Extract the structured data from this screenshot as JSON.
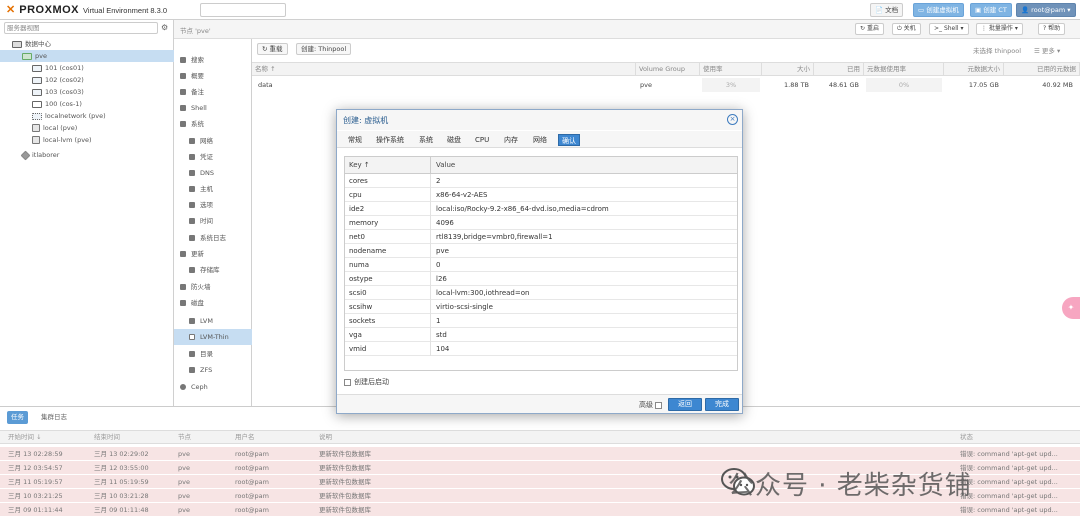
{
  "topbar": {
    "logo_brand": "PROXMOX",
    "logo_product": "Virtual Environment 8.3.0",
    "search_placeholder": "搜索",
    "docs_label": "文档",
    "create_vm_label": "创建虚拟机",
    "create_ct_label": "创建 CT",
    "user_label": "root@pam"
  },
  "tree": {
    "view_label": "服务器视图",
    "items": [
      {
        "label": "数据中心",
        "type": "datacenter"
      },
      {
        "label": "pve",
        "type": "node"
      },
      {
        "label": "101 (cos01)",
        "type": "vm"
      },
      {
        "label": "102 (cos02)",
        "type": "vm"
      },
      {
        "label": "103 (cos03)",
        "type": "vm"
      },
      {
        "label": "100 (cos-1)",
        "type": "vm"
      },
      {
        "label": "localnetwork (pve)",
        "type": "network"
      },
      {
        "label": "local (pve)",
        "type": "storage"
      },
      {
        "label": "local-lvm (pve)",
        "type": "storage"
      },
      {
        "label": "itlaborer",
        "type": "tag"
      }
    ]
  },
  "header": {
    "breadcrumb": "节点 'pve'",
    "btn_restart": "重启",
    "btn_shutdown": "关机",
    "btn_shell": "Shell",
    "btn_bulk": "批量操作",
    "btn_help": "帮助"
  },
  "nav": {
    "items": [
      {
        "label": "搜索",
        "sub": false
      },
      {
        "label": "概要",
        "sub": false
      },
      {
        "label": "备注",
        "sub": false
      },
      {
        "label": "Shell",
        "sub": false
      },
      {
        "label": "系统",
        "sub": false
      },
      {
        "label": "网络",
        "sub": true
      },
      {
        "label": "凭证",
        "sub": true
      },
      {
        "label": "DNS",
        "sub": true
      },
      {
        "label": "主机",
        "sub": true
      },
      {
        "label": "选项",
        "sub": true
      },
      {
        "label": "时间",
        "sub": true
      },
      {
        "label": "系统日志",
        "sub": true
      },
      {
        "label": "更新",
        "sub": false
      },
      {
        "label": "存储库",
        "sub": true
      },
      {
        "label": "防火墙",
        "sub": false
      },
      {
        "label": "磁盘",
        "sub": false
      },
      {
        "label": "LVM",
        "sub": true
      },
      {
        "label": "LVM-Thin",
        "sub": true
      },
      {
        "label": "目录",
        "sub": true
      },
      {
        "label": "ZFS",
        "sub": true
      },
      {
        "label": "Ceph",
        "sub": false
      }
    ]
  },
  "main": {
    "toolbar": {
      "reload": "重载",
      "create_thinpool": "创建: Thinpool",
      "selected_label": "未选择 thinpool",
      "more_label": "更多"
    },
    "columns": [
      "名称 ↑",
      "Volume Group",
      "使用率",
      "大小",
      "已用",
      "元数据使用率",
      "元数据大小",
      "已用的元数据"
    ],
    "rows": [
      {
        "name": "data",
        "vg": "pve",
        "usage": "3%",
        "size": "1.88 TB",
        "used": "48.61 GB",
        "meta_usage": "0%",
        "meta_size": "17.05 GB",
        "meta_used": "40.92 MB"
      }
    ]
  },
  "dialog": {
    "title": "创建: 虚拟机",
    "tabs": [
      "常规",
      "操作系统",
      "系统",
      "磁盘",
      "CPU",
      "内存",
      "网络",
      "确认"
    ],
    "active_tab": "确认",
    "col_key": "Key ↑",
    "col_value": "Value",
    "rows": [
      {
        "k": "cores",
        "v": "2"
      },
      {
        "k": "cpu",
        "v": "x86-64-v2-AES"
      },
      {
        "k": "ide2",
        "v": "local:iso/Rocky-9.2-x86_64-dvd.iso,media=cdrom"
      },
      {
        "k": "memory",
        "v": "4096"
      },
      {
        "k": "net0",
        "v": "rtl8139,bridge=vmbr0,firewall=1"
      },
      {
        "k": "nodename",
        "v": "pve"
      },
      {
        "k": "numa",
        "v": "0"
      },
      {
        "k": "ostype",
        "v": "l26"
      },
      {
        "k": "scsi0",
        "v": "local-lvm:300,iothread=on"
      },
      {
        "k": "scsihw",
        "v": "virtio-scsi-single"
      },
      {
        "k": "sockets",
        "v": "1"
      },
      {
        "k": "vga",
        "v": "std"
      },
      {
        "k": "vmid",
        "v": "104"
      }
    ],
    "start_after_label": "创建后启动",
    "advanced_label": "高级",
    "back_label": "返回",
    "finish_label": "完成"
  },
  "bottom": {
    "tab_tasks": "任务",
    "tab_cluster_log": "集群日志",
    "columns": [
      "开始时间 ↓",
      "结束时间",
      "节点",
      "用户名",
      "说明",
      "状态"
    ],
    "rows": [
      {
        "start": "三月 13 02:28:59",
        "end": "三月 13 02:29:02",
        "node": "pve",
        "user": "root@pam",
        "desc": "更新软件包数据库",
        "status": "错误: command 'apt-get upd..."
      },
      {
        "start": "三月 12 03:54:57",
        "end": "三月 12 03:55:00",
        "node": "pve",
        "user": "root@pam",
        "desc": "更新软件包数据库",
        "status": "错误: command 'apt-get upd..."
      },
      {
        "start": "三月 11 05:19:57",
        "end": "三月 11 05:19:59",
        "node": "pve",
        "user": "root@pam",
        "desc": "更新软件包数据库",
        "status": "错误: command 'apt-get upd..."
      },
      {
        "start": "三月 10 03:21:25",
        "end": "三月 10 03:21:28",
        "node": "pve",
        "user": "root@pam",
        "desc": "更新软件包数据库",
        "status": "错误: command 'apt-get upd..."
      },
      {
        "start": "三月 09 01:11:44",
        "end": "三月 09 01:11:48",
        "node": "pve",
        "user": "root@pam",
        "desc": "更新软件包数据库",
        "status": "错误: command 'apt-get upd..."
      }
    ]
  },
  "watermark": "公众号 · 老柴杂货铺"
}
